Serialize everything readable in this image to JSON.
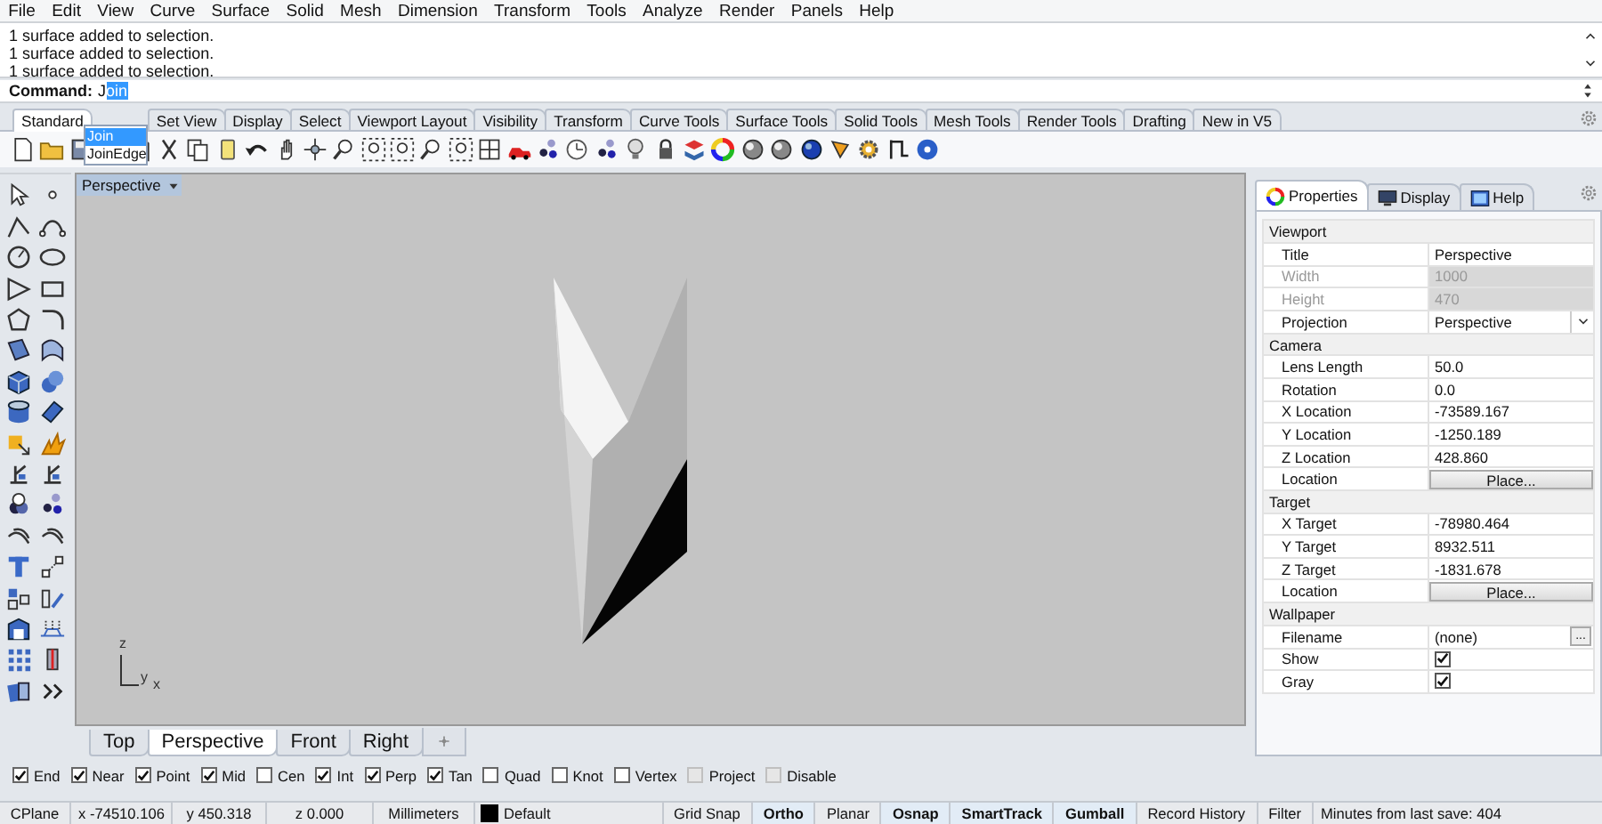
{
  "menu": [
    "File",
    "Edit",
    "View",
    "Curve",
    "Surface",
    "Solid",
    "Mesh",
    "Dimension",
    "Transform",
    "Tools",
    "Analyze",
    "Render",
    "Panels",
    "Help"
  ],
  "command_history": [
    "1 surface added to selection.",
    "1 surface added to selection.",
    "1 surface added to selection."
  ],
  "command": {
    "prompt": "Command:",
    "typed": "J",
    "completion": "oin"
  },
  "autocomplete": [
    {
      "label": "Join",
      "selected": true
    },
    {
      "label": "JoinEdge",
      "selected": false
    }
  ],
  "toolbar_tabs": [
    {
      "label": "Standard",
      "selected": true
    },
    {
      "label": "Set View",
      "selected": false
    },
    {
      "label": "Display",
      "selected": false
    },
    {
      "label": "Select",
      "selected": false
    },
    {
      "label": "Viewport Layout",
      "selected": false
    },
    {
      "label": "Visibility",
      "selected": false
    },
    {
      "label": "Transform",
      "selected": false
    },
    {
      "label": "Curve Tools",
      "selected": false
    },
    {
      "label": "Surface Tools",
      "selected": false
    },
    {
      "label": "Solid Tools",
      "selected": false
    },
    {
      "label": "Mesh Tools",
      "selected": false
    },
    {
      "label": "Render Tools",
      "selected": false
    },
    {
      "label": "Drafting",
      "selected": false
    },
    {
      "label": "New in V5",
      "selected": false
    }
  ],
  "viewport": {
    "title": "Perspective",
    "axis_labels": [
      "z",
      "y",
      "x"
    ]
  },
  "viewport_tabs": [
    {
      "label": "Top",
      "selected": false
    },
    {
      "label": "Perspective",
      "selected": true
    },
    {
      "label": "Front",
      "selected": false
    },
    {
      "label": "Right",
      "selected": false
    }
  ],
  "properties": {
    "tabs": [
      {
        "label": "Properties",
        "selected": true
      },
      {
        "label": "Display",
        "selected": false
      },
      {
        "label": "Help",
        "selected": false
      }
    ],
    "sections": [
      {
        "title": "Viewport",
        "rows": [
          {
            "label": "Title",
            "value": "Perspective",
            "kind": "text",
            "disabled": false
          },
          {
            "label": "Width",
            "value": "1000",
            "kind": "text",
            "disabled": true
          },
          {
            "label": "Height",
            "value": "470",
            "kind": "text",
            "disabled": true
          },
          {
            "label": "Projection",
            "value": "Perspective",
            "kind": "dropdown",
            "disabled": false
          }
        ]
      },
      {
        "title": "Camera",
        "rows": [
          {
            "label": "Lens Length",
            "value": "50.0",
            "kind": "text",
            "disabled": false
          },
          {
            "label": "Rotation",
            "value": "0.0",
            "kind": "text",
            "disabled": false
          },
          {
            "label": "X Location",
            "value": "-73589.167",
            "kind": "text",
            "disabled": false
          },
          {
            "label": "Y Location",
            "value": "-1250.189",
            "kind": "text",
            "disabled": false
          },
          {
            "label": "Z Location",
            "value": "428.860",
            "kind": "text",
            "disabled": false
          },
          {
            "label": "Location",
            "value": "Place...",
            "kind": "button",
            "disabled": false
          }
        ]
      },
      {
        "title": "Target",
        "rows": [
          {
            "label": "X Target",
            "value": "-78980.464",
            "kind": "text",
            "disabled": false
          },
          {
            "label": "Y Target",
            "value": "8932.511",
            "kind": "text",
            "disabled": false
          },
          {
            "label": "Z Target",
            "value": "-1831.678",
            "kind": "text",
            "disabled": false
          },
          {
            "label": "Location",
            "value": "Place...",
            "kind": "button",
            "disabled": false
          }
        ]
      },
      {
        "title": "Wallpaper",
        "rows": [
          {
            "label": "Filename",
            "value": "(none)",
            "button": "...",
            "kind": "file",
            "disabled": false
          },
          {
            "label": "Show",
            "kind": "checkbox",
            "checked": true,
            "disabled": false
          },
          {
            "label": "Gray",
            "kind": "checkbox",
            "checked": true,
            "disabled": false
          }
        ]
      }
    ]
  },
  "osnaps": [
    {
      "label": "End",
      "checked": true,
      "disabled": false
    },
    {
      "label": "Near",
      "checked": true,
      "disabled": false
    },
    {
      "label": "Point",
      "checked": true,
      "disabled": false
    },
    {
      "label": "Mid",
      "checked": true,
      "disabled": false
    },
    {
      "label": "Cen",
      "checked": false,
      "disabled": false
    },
    {
      "label": "Int",
      "checked": true,
      "disabled": false
    },
    {
      "label": "Perp",
      "checked": true,
      "disabled": false
    },
    {
      "label": "Tan",
      "checked": true,
      "disabled": false
    },
    {
      "label": "Quad",
      "checked": false,
      "disabled": false
    },
    {
      "label": "Knot",
      "checked": false,
      "disabled": false
    },
    {
      "label": "Vertex",
      "checked": false,
      "disabled": false
    },
    {
      "label": "Project",
      "checked": false,
      "disabled": true
    },
    {
      "label": "Disable",
      "checked": false,
      "disabled": true
    }
  ],
  "status_bar": {
    "cplane": "CPlane",
    "x": "x -74510.106",
    "y": "y 450.318",
    "z": "z 0.000",
    "units": "Millimeters",
    "layer": {
      "name": "Default",
      "color": "#000000"
    },
    "toggles": [
      {
        "label": "Grid Snap",
        "on": false
      },
      {
        "label": "Ortho",
        "on": true
      },
      {
        "label": "Planar",
        "on": false
      },
      {
        "label": "Osnap",
        "on": true
      },
      {
        "label": "SmartTrack",
        "on": true
      },
      {
        "label": "Gumball",
        "on": true
      },
      {
        "label": "Record History",
        "on": false
      },
      {
        "label": "Filter",
        "on": false
      }
    ],
    "save_info": "Minutes from last save: 404"
  }
}
